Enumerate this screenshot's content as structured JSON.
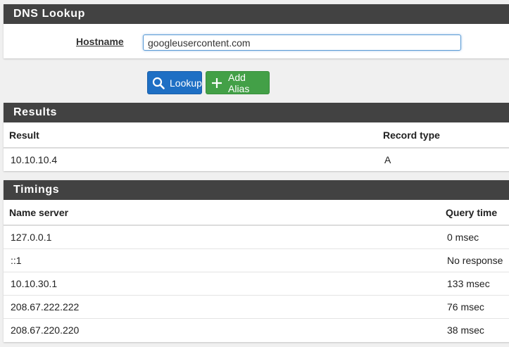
{
  "lookup": {
    "title": "DNS Lookup",
    "hostname_label": "Hostname",
    "hostname_value": "googleusercontent.com",
    "lookup_button": "Lookup",
    "alias_button": "Add Alias"
  },
  "results": {
    "title": "Results",
    "headers": [
      "Result",
      "Record type"
    ],
    "rows": [
      {
        "result": "10.10.10.4",
        "type": "A"
      }
    ]
  },
  "timings": {
    "title": "Timings",
    "headers": [
      "Name server",
      "Query time"
    ],
    "rows": [
      {
        "server": "127.0.0.1",
        "time": "0 msec"
      },
      {
        "server": "::1",
        "time": "No response"
      },
      {
        "server": "10.10.30.1",
        "time": "133 msec"
      },
      {
        "server": "208.67.222.222",
        "time": "76 msec"
      },
      {
        "server": "208.67.220.220",
        "time": "38 msec"
      }
    ]
  },
  "colors": {
    "heading_bg": "#424242",
    "lookup_button": "#1e6fc4",
    "alias_button": "#43a047"
  },
  "icons": {
    "lookup": "search-icon",
    "alias": "plus-icon"
  }
}
